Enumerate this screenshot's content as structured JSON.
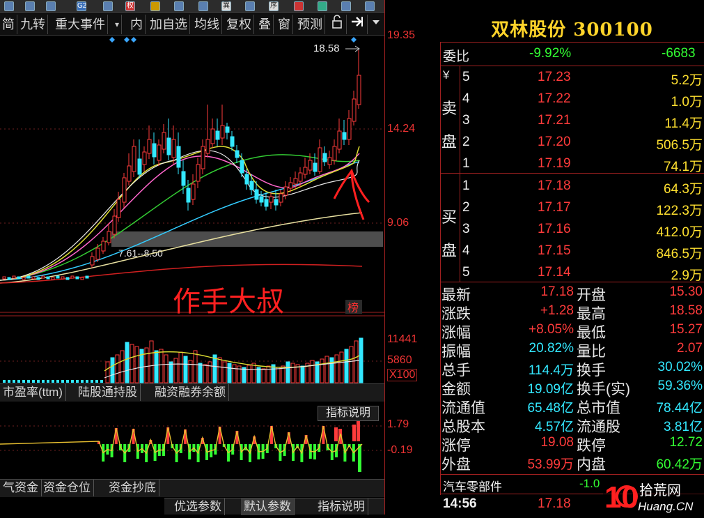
{
  "toolbar": {
    "icons": [
      "app-icon",
      "chart-icon",
      "icon",
      "label-g2",
      "icon",
      "label-quan",
      "icon",
      "icon",
      "icon",
      "label-yi",
      "icon",
      "label-xu",
      "icon",
      "flag-icon",
      "icon",
      "icon"
    ],
    "icon_texts": {
      "g2": "G2",
      "quan": "权",
      "yi": "異",
      "xu": "序"
    }
  },
  "tabs": [
    {
      "label": "简"
    },
    {
      "label": "九转"
    },
    {
      "label": "重大事件"
    },
    {
      "label": "▾"
    },
    {
      "label": "内"
    },
    {
      "label": "加自选"
    },
    {
      "label": "均线"
    },
    {
      "label": "复权"
    },
    {
      "label": "叠"
    },
    {
      "label": "窗"
    },
    {
      "label": "预测"
    }
  ],
  "tab_icons": [
    "lock-icon",
    "arrow-right-icon",
    "dropdown-icon"
  ],
  "main_chart": {
    "price_axis": [
      "19.35",
      "14.24",
      "9.06"
    ],
    "peak_label": "18.58",
    "band_label": "7.61--8.50",
    "watermark_text": "作手大叔",
    "badge": "榜"
  },
  "volume_chart": {
    "axis": [
      "11441",
      "5860",
      "X100"
    ]
  },
  "indicator_tabs": [
    {
      "label": "市盈率(ttm)"
    },
    {
      "label": "陆股通持股"
    },
    {
      "label": "融资融券余额"
    }
  ],
  "indicator_chart": {
    "help_button": "指标说明",
    "axis": [
      "1.79",
      "-0.19"
    ]
  },
  "bottom_tabs": [
    {
      "label": "气资金"
    },
    {
      "label": "资金仓位"
    },
    {
      "label": "资金抄底"
    }
  ],
  "bottom_tabs2": [
    {
      "label": "优选参数"
    },
    {
      "label": "默认参数"
    },
    {
      "label": "指标说明"
    }
  ],
  "stock": {
    "title": "双林股份 300100",
    "weibi_label": "委比",
    "weibi_pct": "-9.92%",
    "weibi_val": "-6683",
    "sell_label": "卖盘",
    "buy_label": "买盘",
    "yen": "¥",
    "sell": [
      {
        "level": "5",
        "price": "17.23",
        "vol": "5.2万"
      },
      {
        "level": "4",
        "price": "17.22",
        "vol": "1.0万"
      },
      {
        "level": "3",
        "price": "17.21",
        "vol": "11.4万"
      },
      {
        "level": "2",
        "price": "17.20",
        "vol": "506.5万"
      },
      {
        "level": "1",
        "price": "17.19",
        "vol": "74.1万"
      }
    ],
    "buy": [
      {
        "level": "1",
        "price": "17.18",
        "vol": "64.3万"
      },
      {
        "level": "2",
        "price": "17.17",
        "vol": "122.3万"
      },
      {
        "level": "3",
        "price": "17.16",
        "vol": "412.0万"
      },
      {
        "level": "4",
        "price": "17.15",
        "vol": "846.5万"
      },
      {
        "level": "5",
        "price": "17.14",
        "vol": "2.9万"
      }
    ],
    "stats": [
      {
        "l1": "最新",
        "v1": "17.18",
        "c1": "red",
        "l2": "开盘",
        "v2": "15.30",
        "c2": "red"
      },
      {
        "l1": "涨跌",
        "v1": "+1.28",
        "c1": "red",
        "l2": "最高",
        "v2": "18.58",
        "c2": "red"
      },
      {
        "l1": "涨幅",
        "v1": "+8.05%",
        "c1": "red",
        "l2": "最低",
        "v2": "15.27",
        "c2": "red"
      },
      {
        "l1": "振幅",
        "v1": "20.82%",
        "c1": "cyn",
        "l2": "量比",
        "v2": "2.07",
        "c2": "red"
      },
      {
        "l1": "总手",
        "v1": "114.4万",
        "c1": "cyn",
        "l2": "换手",
        "v2": "30.02%",
        "c2": "cyn"
      },
      {
        "l1": "金额",
        "v1": "19.09亿",
        "c1": "cyn",
        "l2": "换手(实)",
        "v2": "59.36%",
        "c2": "cyn"
      },
      {
        "l1": "流通值",
        "v1": "65.48亿",
        "c1": "cyn",
        "l2": "总市值",
        "v2": "78.44亿",
        "c2": "cyn"
      },
      {
        "l1": "总股本",
        "v1": "4.57亿",
        "c1": "cyn",
        "l2": "流通股",
        "v2": "3.81亿",
        "c2": "cyn"
      },
      {
        "l1": "涨停",
        "v1": "19.08",
        "c1": "red",
        "l2": "跌停",
        "v2": "12.72",
        "c2": "grn"
      },
      {
        "l1": "外盘",
        "v1": "53.99万",
        "c1": "red",
        "l2": "内盘",
        "v2": "60.42万",
        "c2": "grn"
      }
    ],
    "sector": "汽车零部件",
    "sector_val": "-1.0",
    "time": "14:56",
    "last_price": "17.18"
  },
  "site_logo": {
    "text": "拾荒网",
    "sub": "Huang.CN",
    "num": "10"
  },
  "colors": {
    "up": "#ff3b3b",
    "down": "#33ff33",
    "cyan": "#33e8ff",
    "yellow": "#ffd42a",
    "border": "#a02020"
  }
}
